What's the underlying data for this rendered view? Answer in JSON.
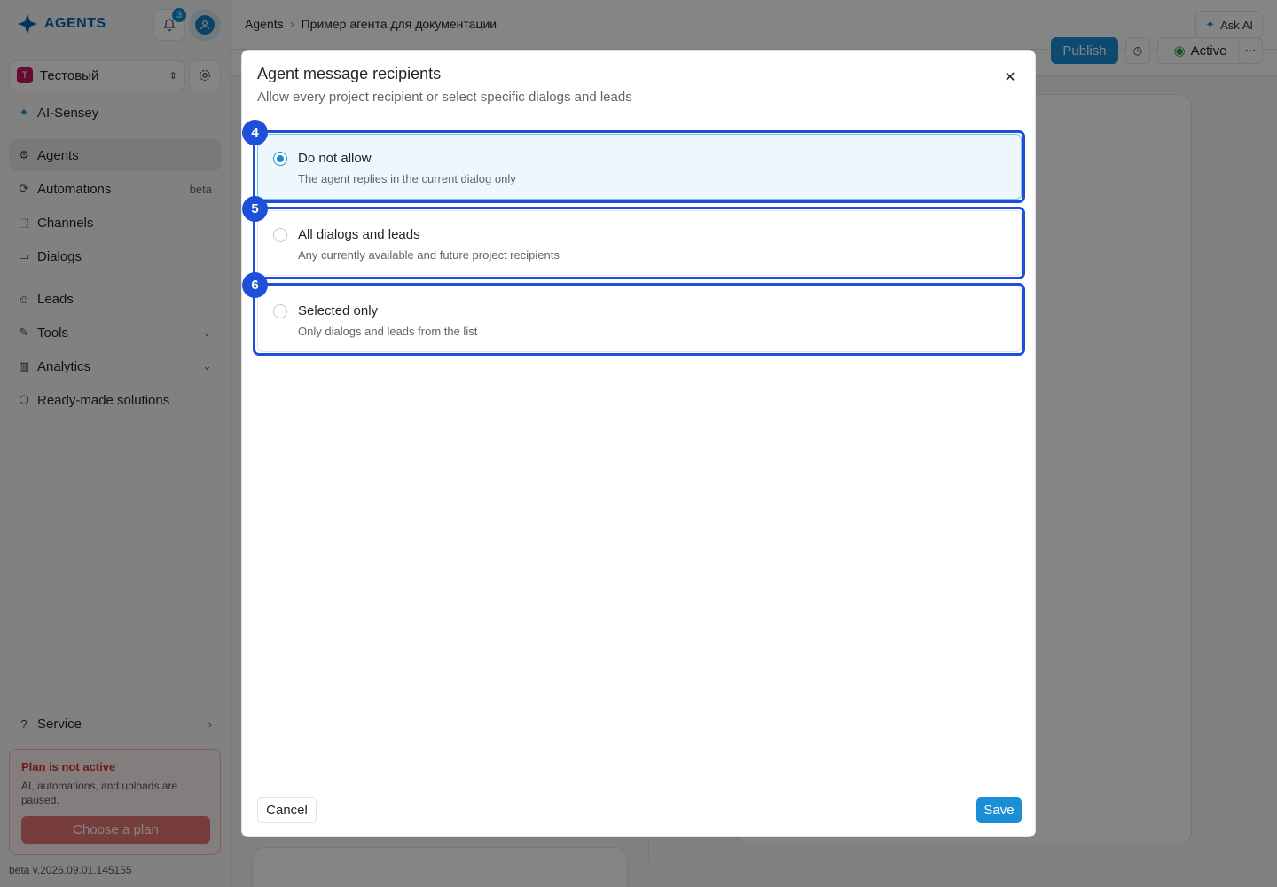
{
  "app": {
    "logo_text": "AGENTS",
    "notification_count": "3",
    "project": {
      "letter": "T",
      "name": "Тестовый"
    },
    "version": "beta v.2026.09.01.145155"
  },
  "sidebar": {
    "items": [
      {
        "label": "AI-Sensey",
        "icon": "sparkle-icon"
      },
      {
        "label": "Agents",
        "icon": "agents-icon",
        "active": true
      },
      {
        "label": "Automations",
        "icon": "automations-icon",
        "suffix": "beta"
      },
      {
        "label": "Channels",
        "icon": "channels-icon"
      },
      {
        "label": "Dialogs",
        "icon": "dialogs-icon"
      },
      {
        "label": "Leads",
        "icon": "user-icon"
      },
      {
        "label": "Tools",
        "icon": "tools-icon"
      },
      {
        "label": "Analytics",
        "icon": "chart-icon"
      },
      {
        "label": "Ready-made solutions",
        "icon": "box-icon"
      },
      {
        "label": "Service",
        "icon": "help-icon"
      }
    ],
    "plan": {
      "title": "Plan is not active",
      "text": "AI, automations, and uploads are paused.",
      "button": "Choose a plan"
    }
  },
  "header": {
    "breadcrumb": [
      "Agents",
      "Пример агента для документации"
    ],
    "ask_ai": "Ask AI"
  },
  "toolbar": {
    "publish": "Publish",
    "status": "Active"
  },
  "modal": {
    "title": "Agent message recipients",
    "subtitle": "Allow every project recipient or select specific dialogs and leads",
    "options": [
      {
        "marker": "4",
        "label": "Do not allow",
        "desc": "The agent replies in the current dialog only",
        "selected": true
      },
      {
        "marker": "5",
        "label": "All dialogs and leads",
        "desc": "Any currently available and future project recipients",
        "selected": false
      },
      {
        "marker": "6",
        "label": "Selected only",
        "desc": "Only dialogs and leads from the list",
        "selected": false
      }
    ],
    "cancel": "Cancel",
    "save": "Save"
  },
  "colors": {
    "accent": "#1a8fd6",
    "highlight": "#1d4fd8",
    "danger": "#d32f2f"
  }
}
